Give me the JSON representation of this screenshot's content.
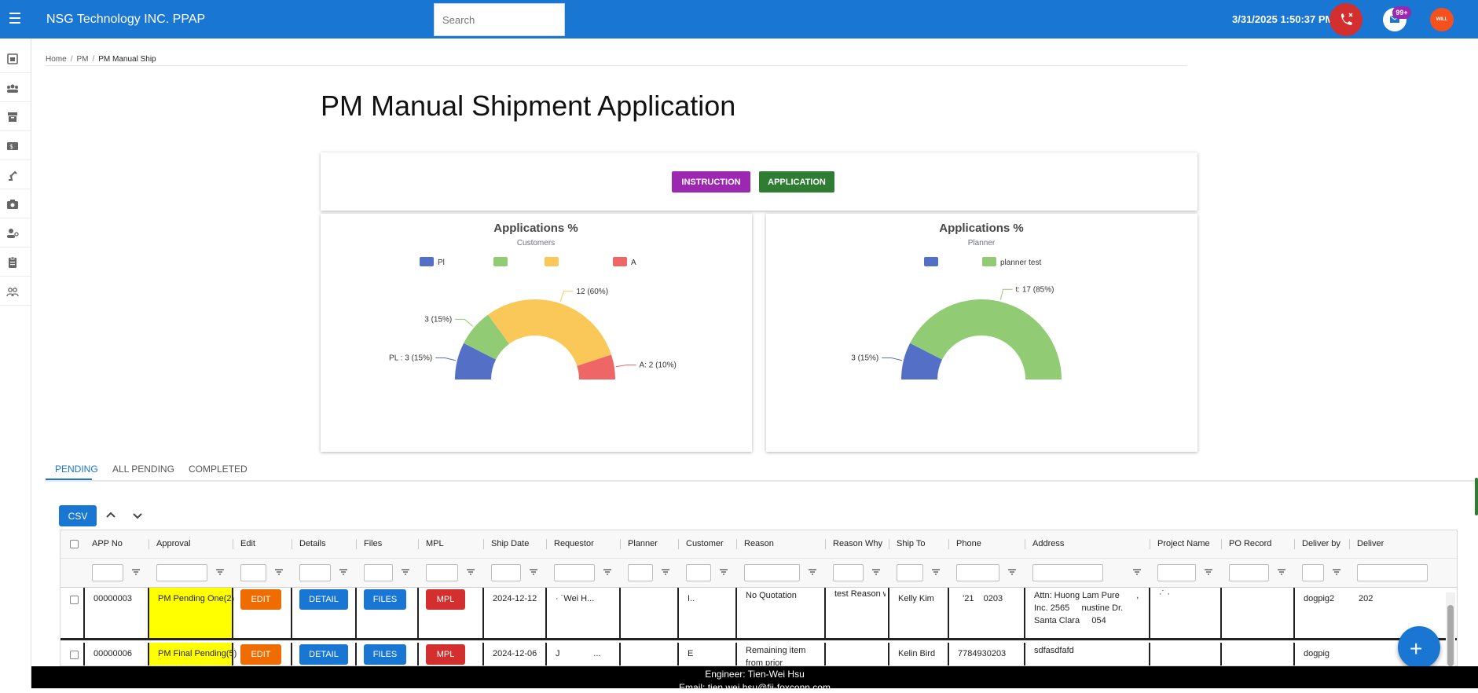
{
  "header": {
    "app_title": "NSG Technology INC. PPAP",
    "search_placeholder": "Search",
    "datetime": "3/31/2025 1:50:37 PM",
    "mail_badge": "99+",
    "avatar_text": "WILL"
  },
  "sidebar": {
    "items": [
      "dashboard-icon",
      "group-icon",
      "archive-icon",
      "dollar-icon",
      "robot-arm-icon",
      "camera-icon",
      "engineer-icon",
      "clipboard-icon",
      "people-icon"
    ]
  },
  "breadcrumb": {
    "home": "Home",
    "pm": "PM",
    "current": "PM Manual Ship"
  },
  "page_title": "PM Manual Shipment Application",
  "buttons": {
    "instruction": "INSTRUCTION",
    "application": "APPLICATION"
  },
  "chart_data": [
    {
      "type": "pie",
      "title": "Applications %",
      "subtitle": "Customers",
      "legend_placement": "top",
      "labels": [
        "Pl",
        "",
        "",
        "A"
      ],
      "values": [
        3,
        3,
        12,
        2
      ],
      "percents": [
        15,
        15,
        60,
        10
      ],
      "colors": [
        "#5470c6",
        "#91cc75",
        "#fac858",
        "#ee6666"
      ],
      "data_labels": [
        "PL       : 3 (15%)",
        "3 (15%)",
        "12 (60%)",
        "A: 2 (10%)"
      ],
      "legend_labels": [
        "Pl",
        "",
        "",
        "A"
      ]
    },
    {
      "type": "pie",
      "title": "Applications %",
      "subtitle": "Planner",
      "legend_placement": "top",
      "labels": [
        "",
        "planner test"
      ],
      "values": [
        3,
        17
      ],
      "percents": [
        15,
        85
      ],
      "colors": [
        "#5470c6",
        "#91cc75"
      ],
      "data_labels": [
        "3 (15%)",
        "t: 17 (85%)"
      ],
      "legend_labels": [
        "",
        "planner test"
      ]
    }
  ],
  "tabs": [
    "PENDING",
    "ALL PENDING",
    "COMPLETED"
  ],
  "toolbar": {
    "csv": "CSV"
  },
  "grid": {
    "columns": [
      "APP No",
      "Approval",
      "Edit",
      "Details",
      "Files",
      "MPL",
      "Ship Date",
      "Requestor",
      "Planner",
      "Customer",
      "Reason",
      "Reason Why",
      "Ship To",
      "Phone",
      "Address",
      "Project Name",
      "PO Record",
      "Deliver by",
      "Deliver"
    ],
    "row_buttons": {
      "edit": "EDIT",
      "detail": "DETAIL",
      "files": "FILES",
      "mpl": "MPL"
    },
    "rows": [
      {
        "app_no": "00000003",
        "approval": "PM Pending One(2)",
        "ship_date": "2024-12-12",
        "requestor": "·  ˙Wei H...",
        "planner": "",
        "customer": "I..",
        "reason": "No Quotation",
        "reason_why": "test Reason why",
        "ship_to": "Kelly Kim",
        "phone": "  '21    0203",
        "address": "Attn: Huong Lam Pure       , Inc. 2565     nustine Dr. Santa Clara     054",
        "project_name": "·˙ ·",
        "po_record": "",
        "deliver_by": "dogpig2",
        "deliver": "202"
      },
      {
        "app_no": "00000006",
        "approval": "PM Final Pending(5)",
        "ship_date": "2024-12-06",
        "requestor": "J              ...",
        "planner": "",
        "customer": "E",
        "reason": "Remaining item from prior",
        "reason_why": "",
        "ship_to": "Kelin Bird",
        "phone": "7784930203",
        "address": "sdfasdfafd",
        "project_name": "",
        "po_record": "",
        "deliver_by": "dogpig",
        "deliver": ""
      }
    ]
  },
  "footer": {
    "engineer": "Engineer: Tien-Wei Hsu",
    "email": "Email: tien.wei.hsu@fii-foxconn.com"
  },
  "colors": {
    "primary": "#1976d2",
    "instruction": "#9c27b0",
    "application": "#2e7d32",
    "edit": "#ef6c00",
    "mpl": "#d32f2f",
    "approval_highlight": "#ffff00"
  }
}
